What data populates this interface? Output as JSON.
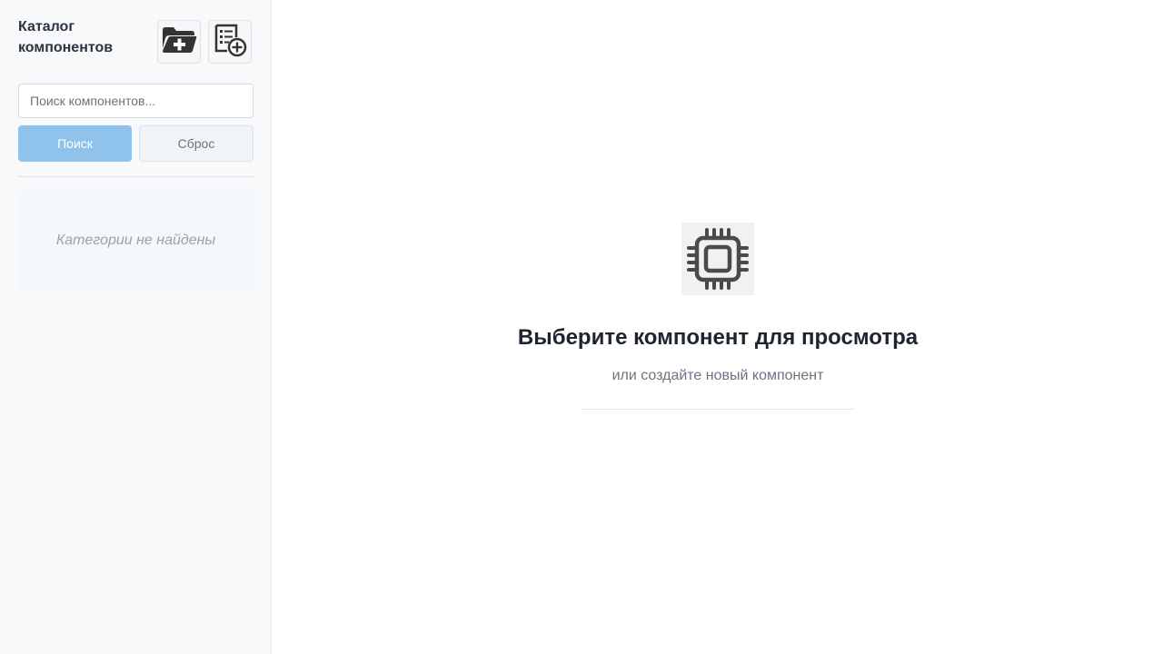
{
  "sidebar": {
    "title": "Каталог компонентов",
    "add_category_icon": "folder-plus-icon",
    "add_component_icon": "document-plus-icon",
    "search": {
      "placeholder": "Поиск компонентов...",
      "value": ""
    },
    "search_button_label": "Поиск",
    "reset_button_label": "Сброс",
    "empty_message": "Категории не найдены"
  },
  "main": {
    "icon": "chip-icon",
    "title": "Выберите компонент для просмотра",
    "subtitle": "или создайте новый компонент"
  },
  "colors": {
    "search_button": "#90c3ec",
    "sidebar_bg": "#f7f9fb"
  }
}
